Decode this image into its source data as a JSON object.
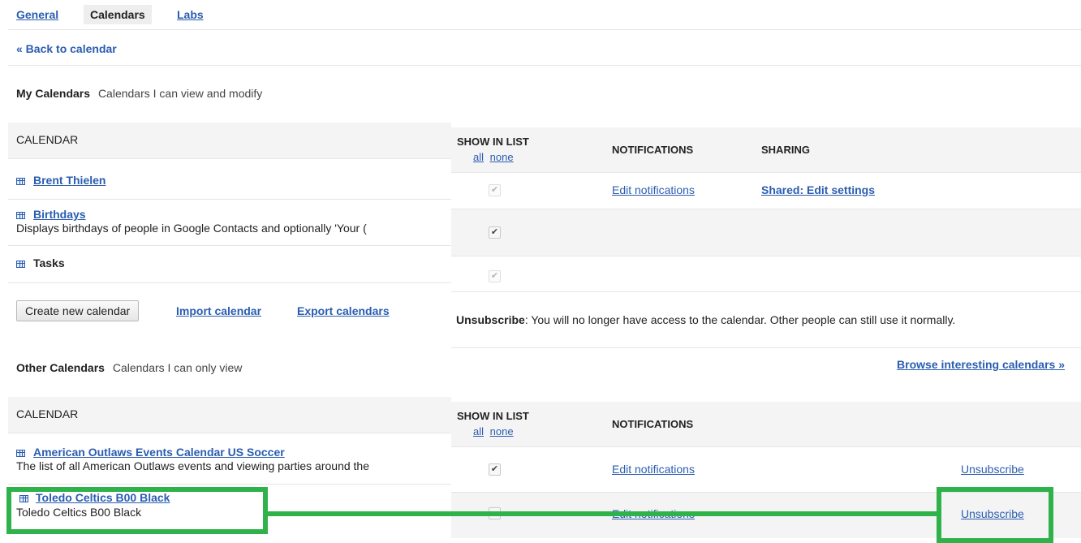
{
  "tabs": [
    {
      "label": "General"
    },
    {
      "label": "Calendars"
    },
    {
      "label": "Labs"
    }
  ],
  "back_link": "« Back to calendar",
  "my_calendars": {
    "title": "My Calendars",
    "subtitle": "Calendars I can view and modify",
    "columns": {
      "calendar": "CALENDAR",
      "show_in_list": "SHOW IN LIST",
      "all": "all",
      "none": "none",
      "notifications": "NOTIFICATIONS",
      "sharing": "SHARING"
    },
    "rows": [
      {
        "name": "Brent Thielen",
        "description": "",
        "show_checked": true,
        "show_disabled": true,
        "notifications": "Edit notifications",
        "sharing": "Shared: Edit settings"
      },
      {
        "name": "Birthdays",
        "description": "Displays birthdays of people in Google Contacts and optionally 'Your (",
        "show_checked": true,
        "show_disabled": false,
        "notifications": "",
        "sharing": ""
      },
      {
        "name": "Tasks",
        "description": "",
        "show_checked": true,
        "show_disabled": true,
        "notifications": "",
        "sharing": ""
      }
    ],
    "buttons": {
      "create": "Create new calendar",
      "import": "Import calendar",
      "export": "Export calendars"
    },
    "unsubscribe_note_bold": "Unsubscribe",
    "unsubscribe_note_rest": ": You will no longer have access to the calendar. Other people can still use it normally."
  },
  "other_calendars": {
    "title": "Other Calendars",
    "subtitle": "Calendars I can only view",
    "browse_link": "Browse interesting calendars »",
    "columns": {
      "calendar": "CALENDAR",
      "show_in_list": "SHOW IN LIST",
      "all": "all",
      "none": "none",
      "notifications": "NOTIFICATIONS"
    },
    "rows": [
      {
        "name": "American Outlaws Events Calendar US Soccer",
        "description": "The list of all American Outlaws events and viewing parties around the",
        "show_checked": true,
        "notifications": "Edit notifications",
        "action": "Unsubscribe"
      },
      {
        "name": "Toledo Celtics B00 Black",
        "description": "Toledo Celtics B00 Black",
        "show_checked": false,
        "notifications": "Edit notifications",
        "action": "Unsubscribe"
      }
    ]
  },
  "colors": {
    "link": "#2a5db0",
    "highlight": "#2fb24a",
    "band": "#f4f4f4"
  },
  "icons": [
    "calendar-icon",
    "checkmark-icon"
  ]
}
